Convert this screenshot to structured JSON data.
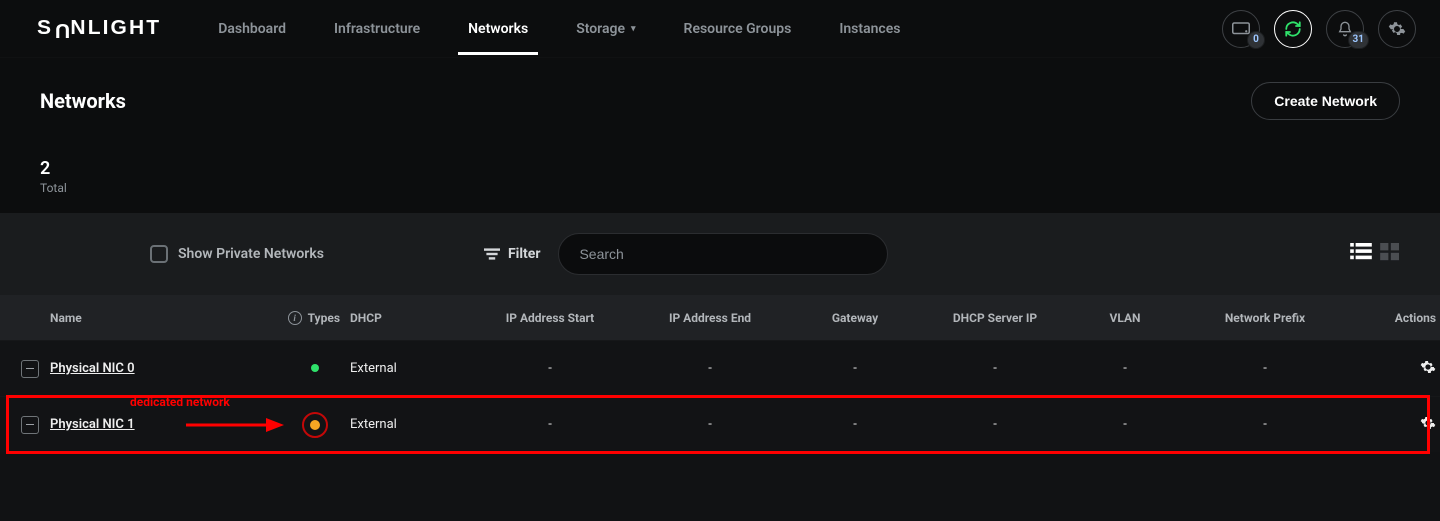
{
  "brand": "SUNLIGHT",
  "nav": {
    "items": [
      {
        "label": "Dashboard"
      },
      {
        "label": "Infrastructure"
      },
      {
        "label": "Networks",
        "active": true
      },
      {
        "label": "Storage",
        "dropdown": true
      },
      {
        "label": "Resource Groups"
      },
      {
        "label": "Instances"
      }
    ]
  },
  "topicons": {
    "messages_badge": "0",
    "notifications_badge": "31"
  },
  "page": {
    "title": "Networks",
    "create_button": "Create Network",
    "total_value": "2",
    "total_label": "Total"
  },
  "toolbar": {
    "show_private_label": "Show Private Networks",
    "filter_label": "Filter",
    "search_placeholder": "Search"
  },
  "columns": {
    "name": "Name",
    "types": "Types",
    "dhcp": "DHCP",
    "ipstart": "IP Address Start",
    "ipend": "IP Address End",
    "gateway": "Gateway",
    "dhcpserver": "DHCP Server IP",
    "vlan": "VLAN",
    "prefix": "Network Prefix",
    "actions": "Actions"
  },
  "rows": [
    {
      "name": "Physical NIC 0",
      "type_color": "green",
      "dhcp": "External",
      "ipstart": "-",
      "ipend": "-",
      "gateway": "-",
      "dhcpserver": "-",
      "vlan": "-",
      "prefix": "-",
      "highlight": false
    },
    {
      "name": "Physical NIC 1",
      "type_color": "orange",
      "dhcp": "External",
      "ipstart": "-",
      "ipend": "-",
      "gateway": "-",
      "dhcpserver": "-",
      "vlan": "-",
      "prefix": "-",
      "highlight": true
    }
  ],
  "annotation": {
    "label": "dedicated network"
  }
}
